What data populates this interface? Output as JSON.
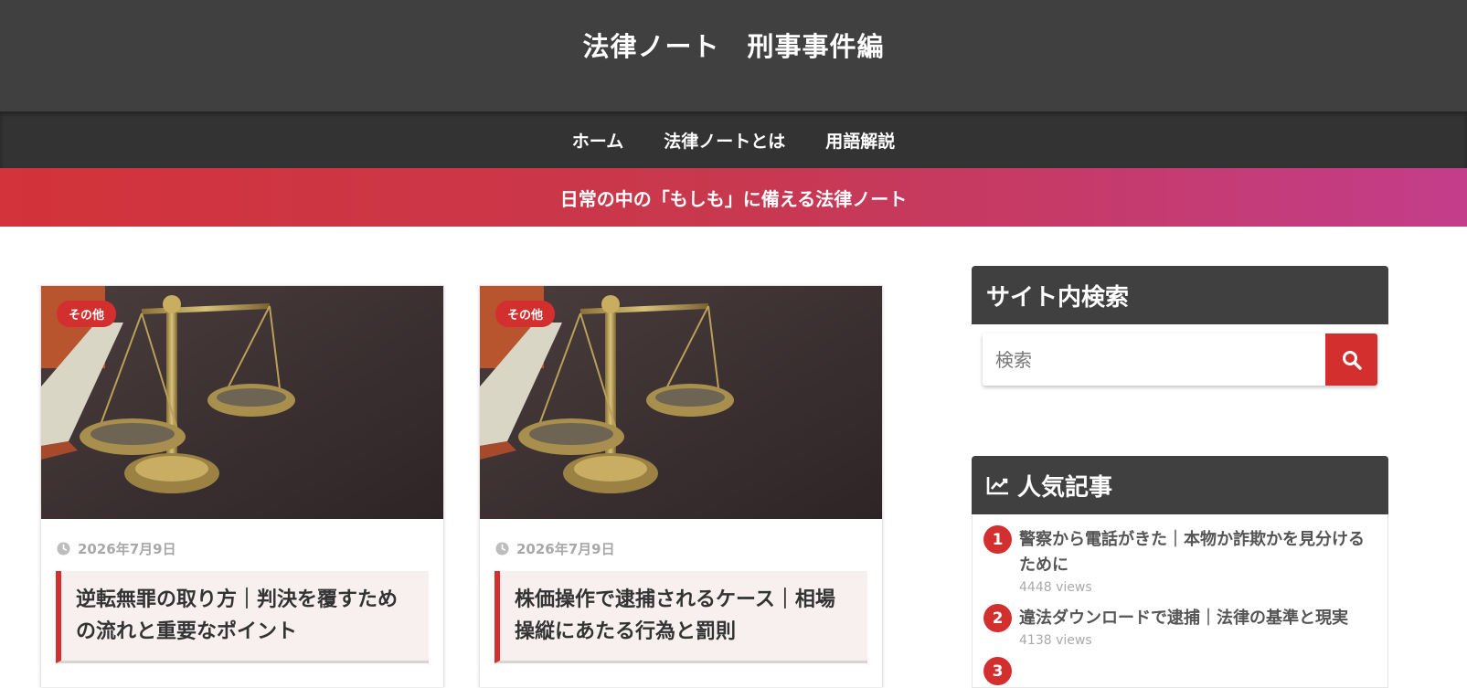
{
  "site": {
    "title": "法律ノート　刑事事件編",
    "tagline": "日常の中の「もしも」に備える法律ノート"
  },
  "nav": {
    "items": [
      {
        "label": "ホーム"
      },
      {
        "label": "法律ノートとは"
      },
      {
        "label": "用語解説"
      }
    ]
  },
  "posts": [
    {
      "category": "その他",
      "date": "2026年7月9日",
      "title": "逆転無罪の取り方｜判決を覆すための流れと重要なポイント",
      "thumbnail": "scales-of-justice-image"
    },
    {
      "category": "その他",
      "date": "2026年7月9日",
      "title": "株価操作で逮捕されるケース｜相場操縦にあたる行為と罰則",
      "thumbnail": "scales-of-justice-image"
    }
  ],
  "sidebar": {
    "search": {
      "heading": "サイト内検索",
      "placeholder": "検索",
      "button_icon": "search-icon"
    },
    "popular": {
      "heading": "人気記事",
      "heading_icon": "trending-chart-icon",
      "items": [
        {
          "rank": "1",
          "title": "警察から電話がきた｜本物か詐欺かを見分けるために",
          "views": "4448 views"
        },
        {
          "rank": "2",
          "title": "違法ダウンロードで逮捕｜法律の基準と現実",
          "views": "4138 views"
        },
        {
          "rank": "3"
        }
      ]
    }
  },
  "colors": {
    "header_bg": "#404040",
    "nav_bg": "#333333",
    "accent": "#d32f2f",
    "gradient_start": "#d3333a",
    "gradient_end": "#c33d8a"
  }
}
